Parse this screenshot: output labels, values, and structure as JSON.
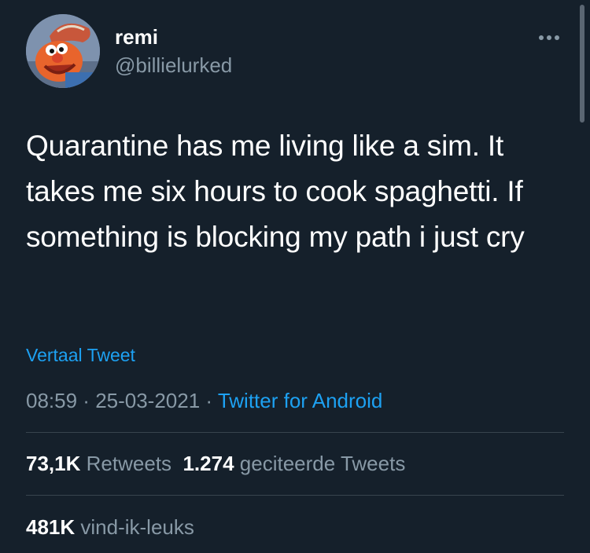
{
  "user": {
    "display_name": "remi",
    "handle": "@billielurked",
    "avatar_icon": "avatar-image"
  },
  "more_icon": "more-horizontal-icon",
  "tweet": {
    "text": "Quarantine has me living like a sim. It takes me six hours to cook spaghetti. If something is blocking my path i just cry",
    "translate_label": "Vertaal Tweet"
  },
  "meta": {
    "time": "08:59",
    "separator1": " · ",
    "date": "25-03-2021",
    "separator2": " · ",
    "source": "Twitter for Android"
  },
  "stats": {
    "retweets_count": "73,1K",
    "retweets_label": "Retweets",
    "quotes_count": "1.274",
    "quotes_label": "geciteerde Tweets",
    "likes_count": "481K",
    "likes_label": "vind-ik-leuks"
  },
  "colors": {
    "background": "#15202b",
    "text": "#ffffff",
    "secondary": "#8899a6",
    "accent": "#1da1f2",
    "divider": "#38444d"
  }
}
